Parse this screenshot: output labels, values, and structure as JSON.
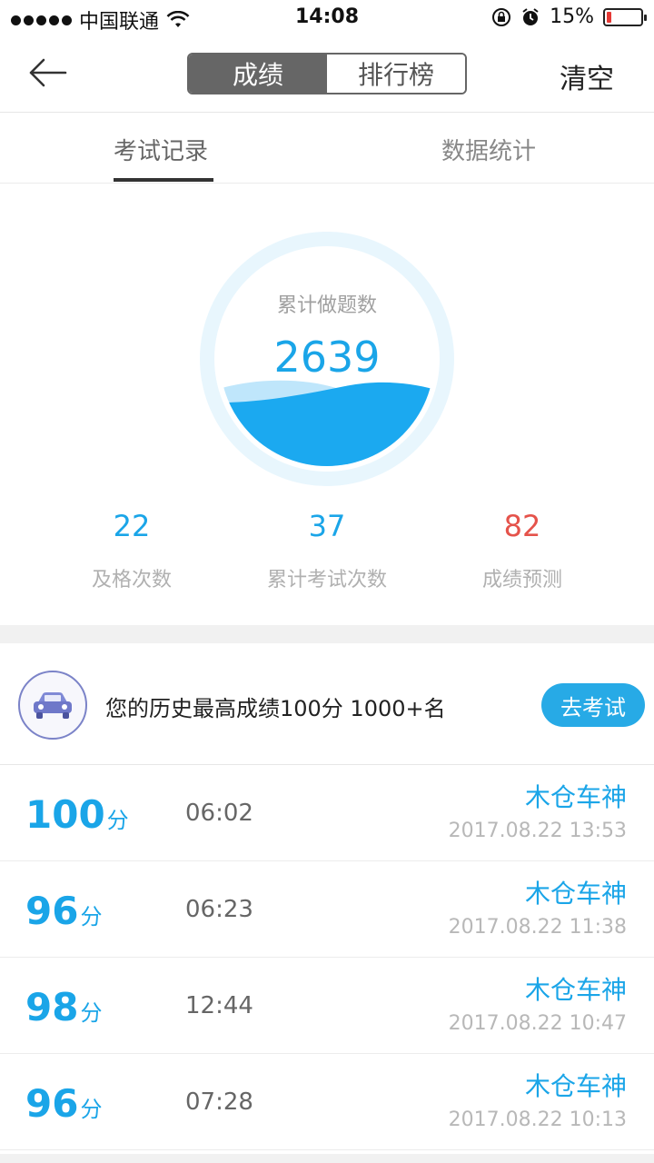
{
  "status_bar": {
    "carrier": "中国联通",
    "time": "14:08",
    "battery": "15%",
    "battery_level": 0.15,
    "icons": [
      "signal-dots-icon",
      "wifi-icon",
      "rotation-lock-icon",
      "alarm-icon",
      "battery-icon"
    ]
  },
  "nav": {
    "back_icon": "arrow-left-icon",
    "segments": [
      "成绩",
      "排行榜"
    ],
    "active_segment": 0,
    "clear_label": "清空"
  },
  "tabs": [
    "考试记录",
    "数据统计"
  ],
  "summary": {
    "label": "累计做题数",
    "value": "2639"
  },
  "stats": [
    {
      "value": "22",
      "label": "及格次数",
      "color": "#1aa5e8"
    },
    {
      "value": "37",
      "label": "累计考试次数",
      "color": "#1aa5e8"
    },
    {
      "value": "82",
      "label": "成绩预测",
      "color": "#e5534b"
    }
  ],
  "best": {
    "icon": "car-icon",
    "text": "您的历史最高成绩100分  1000+名",
    "button_label": "去考试"
  },
  "records": [
    {
      "score": "100",
      "unit": "分",
      "duration": "06:02",
      "user": "木仓车神",
      "date": "2017.08.22 13:53"
    },
    {
      "score": "96",
      "unit": "分",
      "duration": "06:23",
      "user": "木仓车神",
      "date": "2017.08.22 11:38"
    },
    {
      "score": "98",
      "unit": "分",
      "duration": "12:44",
      "user": "木仓车神",
      "date": "2017.08.22 10:47"
    },
    {
      "score": "96",
      "unit": "分",
      "duration": "07:28",
      "user": "木仓车神",
      "date": "2017.08.22 10:13"
    }
  ],
  "colors": {
    "accent": "#1aa5e8",
    "button": "#27aae6",
    "prediction": "#e5534b"
  }
}
